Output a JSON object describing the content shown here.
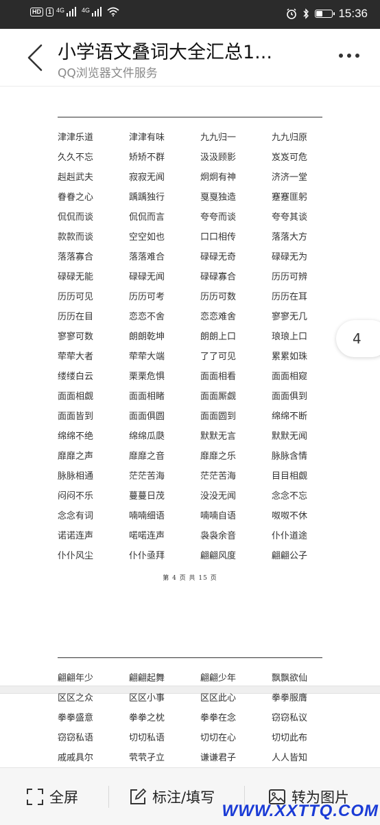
{
  "status_bar": {
    "hd": "HD",
    "sim_slot": "1",
    "network1": "4G",
    "network2": "4G",
    "time": "15:36",
    "icons": [
      "alarm-icon",
      "bluetooth-icon",
      "battery-icon",
      "wifi-icon",
      "signal-icon"
    ]
  },
  "header": {
    "title": "小学语文叠词大全汇总1...",
    "subtitle": "QQ浏览器文件服务",
    "back_icon": "chevron-left-icon",
    "more_icon": "more-dots-icon"
  },
  "page4": {
    "words": [
      "津津乐道",
      "津津有味",
      "九九归一",
      "九九归原",
      "久久不忘",
      "矫矫不群",
      "汲汲顾影",
      "岌岌可危",
      "赳赳武夫",
      "寂寂无闻",
      "炯炯有神",
      "济济一堂",
      "眷眷之心",
      "踽踽独行",
      "戛戛独造",
      "蹇蹇匪躬",
      "侃侃而谈",
      "侃侃而言",
      "夸夸而谈",
      "夸夸其谈",
      "款款而谈",
      "空空如也",
      "口口相传",
      "落落大方",
      "落落寡合",
      "落落难合",
      "碌碌无奇",
      "碌碌无为",
      "碌碌无能",
      "碌碌无闻",
      "碌碌寡合",
      "历历可辨",
      "历历可见",
      "历历可考",
      "历历可数",
      "历历在耳",
      "历历在目",
      "恋恋不舍",
      "恋恋难舍",
      "寥寥无几",
      "寥寥可数",
      "朗朗乾坤",
      "朗朗上口",
      "琅琅上口",
      "荦荦大者",
      "荦荦大端",
      "了了可见",
      "累累如珠",
      "缕缕白云",
      "栗栗危惧",
      "面面相看",
      "面面相窥",
      "面面相觑",
      "面面相睹",
      "面面厮觑",
      "面面俱到",
      "面面皆到",
      "面面俱圆",
      "面面圆到",
      "绵绵不断",
      "绵绵不绝",
      "绵绵瓜瓞",
      "默默无言",
      "默默无闻",
      "靡靡之声",
      "靡靡之音",
      "靡靡之乐",
      "脉脉含情",
      "脉脉相通",
      "茫茫苦海",
      "茫茫苦海",
      "目目相觑",
      "闷闷不乐",
      "蔓蔓日茂",
      "没没无闻",
      "念念不忘",
      "念念有词",
      "喃喃细语",
      "喃喃自语",
      "呶呶不休",
      "诺诺连声",
      "喏喏连声",
      "袅袅余音",
      "仆仆道途",
      "仆仆风尘",
      "仆仆亟拜",
      "翩翩风度",
      "翩翩公子"
    ],
    "footer": "第 4 页 共 15 页"
  },
  "page5": {
    "words": [
      "翩翩年少",
      "翩翩起舞",
      "翩翩少年",
      "飘飘欲仙",
      "区区之众",
      "区区小事",
      "区区此心",
      "拳拳服膺",
      "拳拳盛意",
      "拳拳之枕",
      "拳拳在念",
      "窃窃私议",
      "窃窃私语",
      "切切私语",
      "切切在心",
      "切切此布",
      "戚戚具尔",
      "茕茕孑立",
      "谦谦君子",
      "人人皆知"
    ]
  },
  "page_indicator": "4",
  "toolbar": {
    "fullscreen_label": "全屏",
    "annotate_label": "标注/填写",
    "to_image_label": "转为图片",
    "fullscreen_icon": "fullscreen-icon",
    "annotate_icon": "edit-icon",
    "to_image_icon": "image-icon"
  },
  "watermark": "WWW.XXTTQ.COM"
}
